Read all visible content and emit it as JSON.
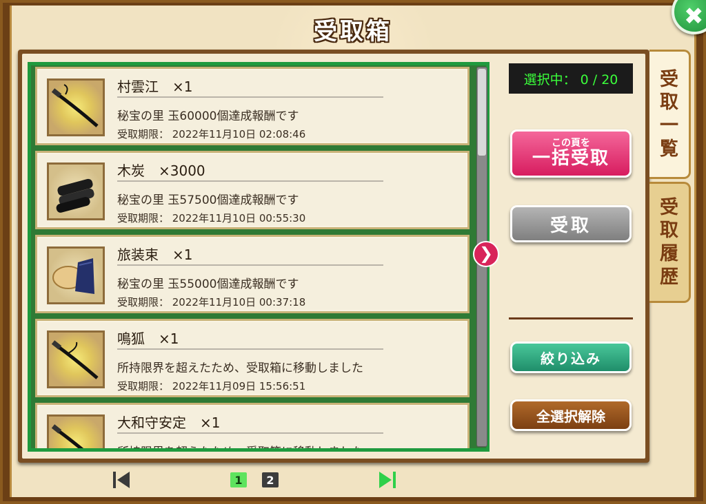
{
  "title": "受取箱",
  "selected_counter": "選択中： 0 / 20",
  "items": [
    {
      "name": "村雲江　×1",
      "desc": "秘宝の里 玉60000個達成報酬です",
      "expiry": "受取期限： 2022年11月10日 02:08:46",
      "icon": "sword-icon"
    },
    {
      "name": "木炭　×3000",
      "desc": "秘宝の里 玉57500個達成報酬です",
      "expiry": "受取期限： 2022年11月10日 00:55:30",
      "icon": "charcoal-icon"
    },
    {
      "name": "旅装束　×1",
      "desc": "秘宝の里 玉55000個達成報酬です",
      "expiry": "受取期限： 2022年11月10日 00:37:18",
      "icon": "travel-outfit-icon"
    },
    {
      "name": "鳴狐　×1",
      "desc": "所持限界を超えたため、受取箱に移動しました",
      "expiry": "受取期限： 2022年11月09日 15:56:51",
      "icon": "sword-icon"
    },
    {
      "name": "大和守安定　×1",
      "desc": "所持限界を超えたため、受取箱に移動しました",
      "expiry": "",
      "icon": "sword-icon"
    }
  ],
  "buttons": {
    "bulk_sub": "この頁を",
    "bulk_main": "一括受取",
    "receive": "受取",
    "filter": "絞り込み",
    "deselect_all": "全選択解除"
  },
  "tabs": {
    "list": [
      "受",
      "取",
      "一",
      "覧"
    ],
    "history": [
      "受",
      "取",
      "履",
      "歴"
    ]
  },
  "pagination": {
    "pages": [
      "1",
      "2"
    ],
    "current_page": "1"
  },
  "colors": {
    "list_border": "#1f9a3e",
    "bulk_button": "#d71c5f",
    "selected_counter_text": "#3bff3b",
    "current_page": "#5ee35e"
  }
}
